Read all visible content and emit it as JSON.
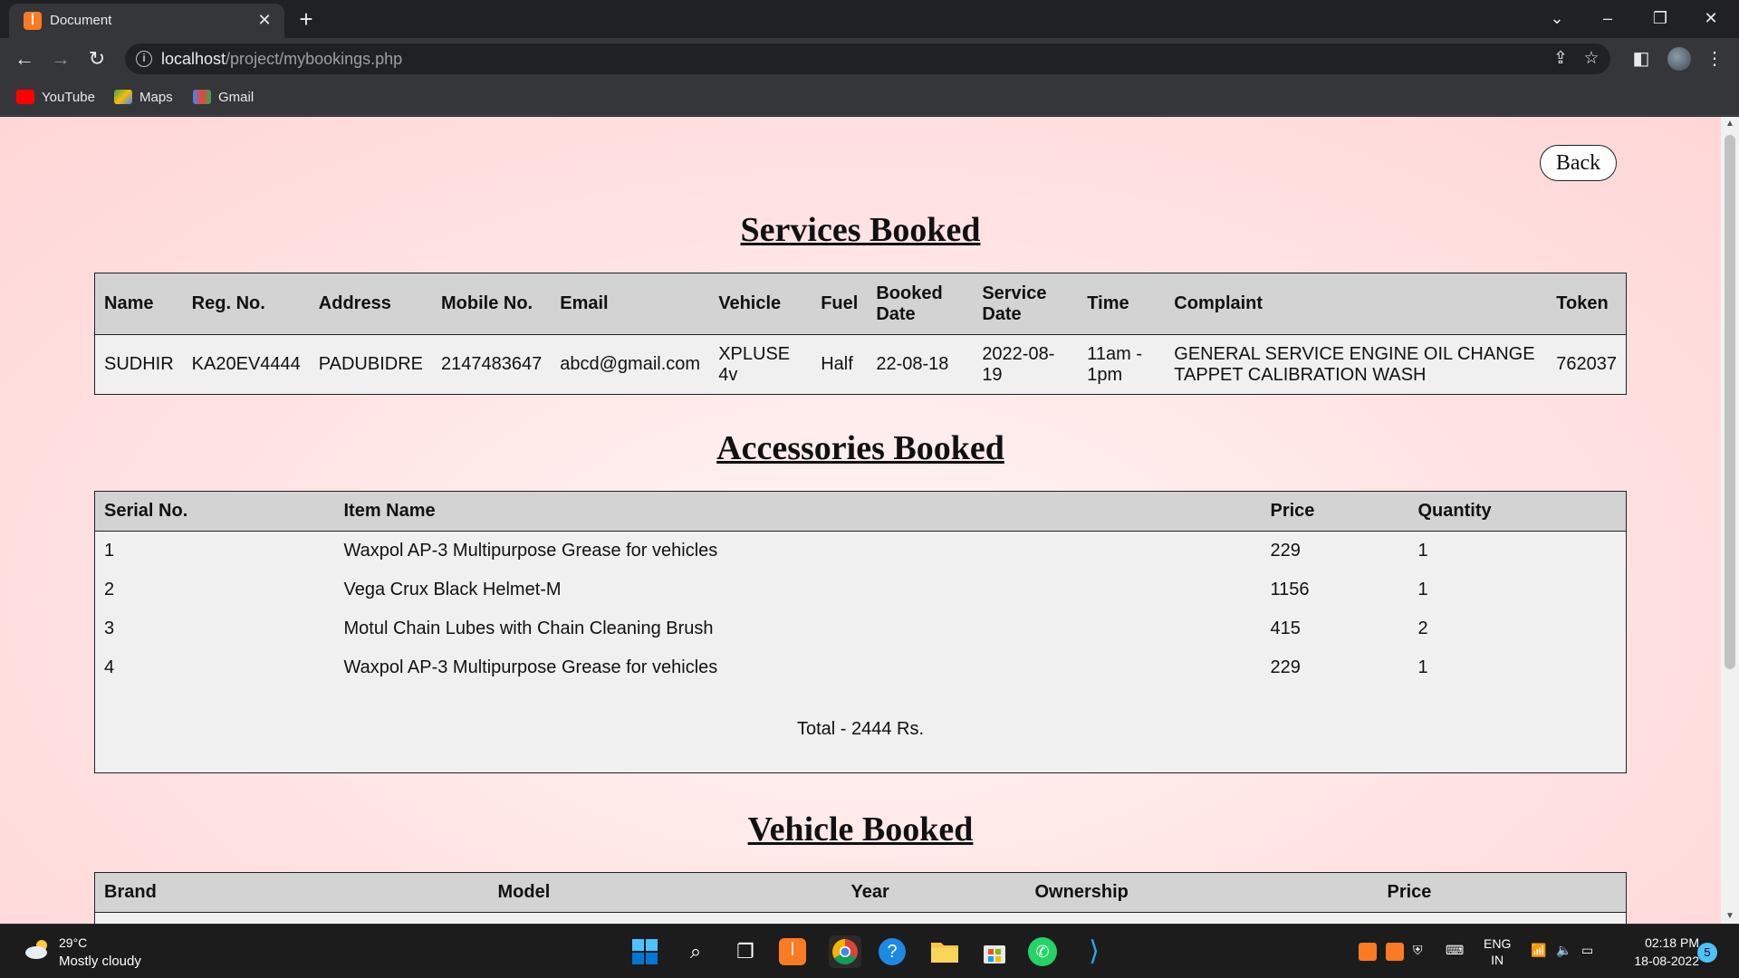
{
  "browser": {
    "tab_title": "Document",
    "url_host": "localhost",
    "url_path": "/project/mybookings.php",
    "bookmarks": [
      "YouTube",
      "Maps",
      "Gmail"
    ]
  },
  "page": {
    "back_label": "Back",
    "services_title": "Services Booked",
    "services_headers": [
      "Name",
      "Reg. No.",
      "Address",
      "Mobile No.",
      "Email",
      "Vehicle",
      "Fuel",
      "Booked Date",
      "Service Date",
      "Time",
      "Complaint",
      "Token"
    ],
    "services_row": {
      "name": "SUDHIR",
      "reg_no": "KA20EV4444",
      "address": "PADUBIDRE",
      "mobile": "2147483647",
      "email": "abcd@gmail.com",
      "vehicle": "XPLUSE 4v",
      "fuel": "Half",
      "booked_date": "22-08-18",
      "service_date": "2022-08-19",
      "time": "11am - 1pm",
      "complaint": "GENERAL SERVICE ENGINE OIL CHANGE TAPPET CALIBRATION WASH",
      "token": "762037"
    },
    "accessories_title": "Accessories Booked",
    "accessories_headers": [
      "Serial No.",
      "Item Name",
      "Price",
      "Quantity"
    ],
    "accessories_rows": [
      {
        "serial": "1",
        "item": "Waxpol AP-3 Multipurpose Grease for vehicles",
        "price": "229",
        "qty": "1"
      },
      {
        "serial": "2",
        "item": "Vega Crux Black Helmet-M",
        "price": "1156",
        "qty": "1"
      },
      {
        "serial": "3",
        "item": "Motul Chain Lubes with Chain Cleaning Brush",
        "price": "415",
        "qty": "2"
      },
      {
        "serial": "4",
        "item": "Waxpol AP-3 Multipurpose Grease for vehicles",
        "price": "229",
        "qty": "1"
      }
    ],
    "accessories_total": "Total - 2444 Rs.",
    "vehicle_title": "Vehicle Booked",
    "vehicle_headers": [
      "Brand",
      "Model",
      "Year",
      "Ownership",
      "Price"
    ]
  },
  "taskbar": {
    "temperature": "29°C",
    "weather": "Mostly cloudy",
    "lang": "ENG",
    "region": "IN",
    "time": "02:18 PM",
    "date": "18-08-2022",
    "notifications": "5"
  },
  "colors": {
    "page_bg": "#ffe3e3",
    "table_header_bg": "#d3d3d3",
    "table_body_bg": "#f0f0f0"
  }
}
